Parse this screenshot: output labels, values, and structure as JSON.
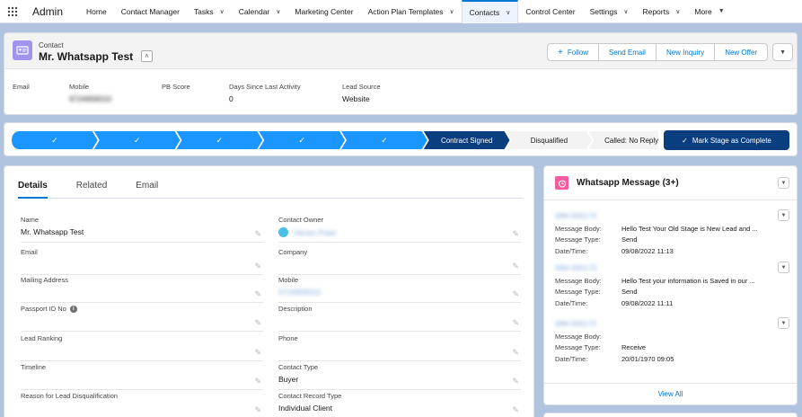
{
  "nav": {
    "app_name": "Admin",
    "items": [
      {
        "label": "Home",
        "has_menu": false
      },
      {
        "label": "Contact Manager",
        "has_menu": false
      },
      {
        "label": "Tasks",
        "has_menu": true
      },
      {
        "label": "Calendar",
        "has_menu": true
      },
      {
        "label": "Marketing Center",
        "has_menu": false
      },
      {
        "label": "Action Plan Templates",
        "has_menu": true
      },
      {
        "label": "Contacts",
        "has_menu": true,
        "active": true
      },
      {
        "label": "Control Center",
        "has_menu": false
      },
      {
        "label": "Settings",
        "has_menu": true
      },
      {
        "label": "Reports",
        "has_menu": true
      },
      {
        "label": "More",
        "has_menu": true
      }
    ]
  },
  "header": {
    "object_label": "Contact",
    "record_name": "Mr. Whatsapp Test",
    "buttons": {
      "follow": "Follow",
      "send_email": "Send Email",
      "new_inquiry": "New Inquiry",
      "new_offer": "New Offer"
    },
    "fields": [
      {
        "label": "Email",
        "value": ""
      },
      {
        "label": "Mobile",
        "value": "9724958310",
        "blurred": true
      },
      {
        "label": "PB Score",
        "value": ""
      },
      {
        "label": "Days Since Last Activity",
        "value": "0"
      },
      {
        "label": "Lead Source",
        "value": "Website"
      }
    ]
  },
  "path": {
    "completed_count": 5,
    "current": "Contract Signed",
    "stages_after": [
      "Disqualified",
      "Called: No Reply"
    ],
    "mark_button": "Mark Stage as Complete",
    "colors": {
      "complete": "#1b96ff",
      "current": "#0b3e7f",
      "incomplete": "#f3f3f3"
    }
  },
  "details": {
    "tabs": [
      "Details",
      "Related",
      "Email"
    ],
    "active_tab": "Details",
    "left_fields": [
      {
        "label": "Name",
        "value": "Mr. Whatsapp Test"
      },
      {
        "label": "Email",
        "value": ""
      },
      {
        "label": "Mailing Address",
        "value": ""
      },
      {
        "label": "Passport ID No",
        "value": "",
        "info": true
      },
      {
        "label": "Lead Ranking",
        "value": ""
      },
      {
        "label": "Timeline",
        "value": ""
      },
      {
        "label": "Reason for Lead Disqualification",
        "value": ""
      }
    ],
    "right_fields": [
      {
        "label": "Contact Owner",
        "value": "Vikram Patel",
        "blurred": true,
        "owner": true
      },
      {
        "label": "Company",
        "value": ""
      },
      {
        "label": "Mobile",
        "value": "9724958310",
        "blurred": true
      },
      {
        "label": "Description",
        "value": ""
      },
      {
        "label": "Phone",
        "value": ""
      },
      {
        "label": "Contact Type",
        "value": "Buyer"
      },
      {
        "label": "Contact Record Type",
        "value": "Individual Client"
      }
    ]
  },
  "whatsapp": {
    "title": "Whatsapp Message (3+)",
    "labels": {
      "body": "Message Body:",
      "type": "Message Type:",
      "date": "Date/Time:"
    },
    "messages": [
      {
        "name": "WM-000174",
        "body": "Hello Test Your Old Stage is New Lead and ...",
        "type": "Send",
        "date": "09/08/2022 11:13"
      },
      {
        "name": "WM-000173",
        "body": "Hello Test your information is Saved in our ...",
        "type": "Send",
        "date": "09/08/2022 11:11"
      },
      {
        "name": "WM-000172",
        "body": "",
        "type": "Receive",
        "date": "20/01/1970 09:05"
      }
    ],
    "view_all": "View All"
  }
}
